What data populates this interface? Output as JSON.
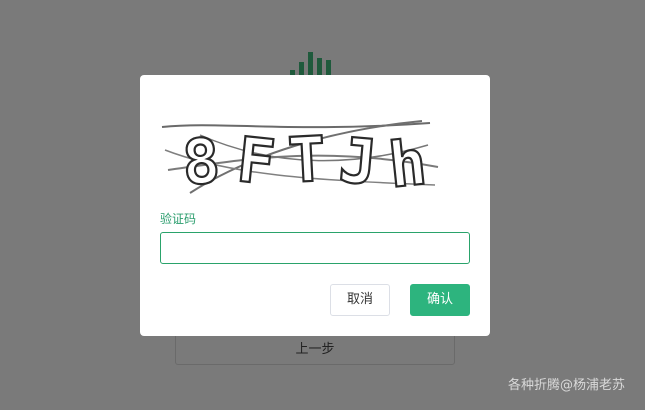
{
  "background": {
    "prev_button_label": "上一步",
    "watermark": "各种折腾@杨浦老苏"
  },
  "dialog": {
    "captcha": {
      "text": "8FTJh"
    },
    "code_label": "验证码",
    "code_value": "",
    "cancel_label": "取消",
    "confirm_label": "确认"
  },
  "colors": {
    "overlay": "#7a7a7a",
    "accent": "#2db47e",
    "label": "#2a9d6d",
    "logo": "#1f5a3c"
  }
}
